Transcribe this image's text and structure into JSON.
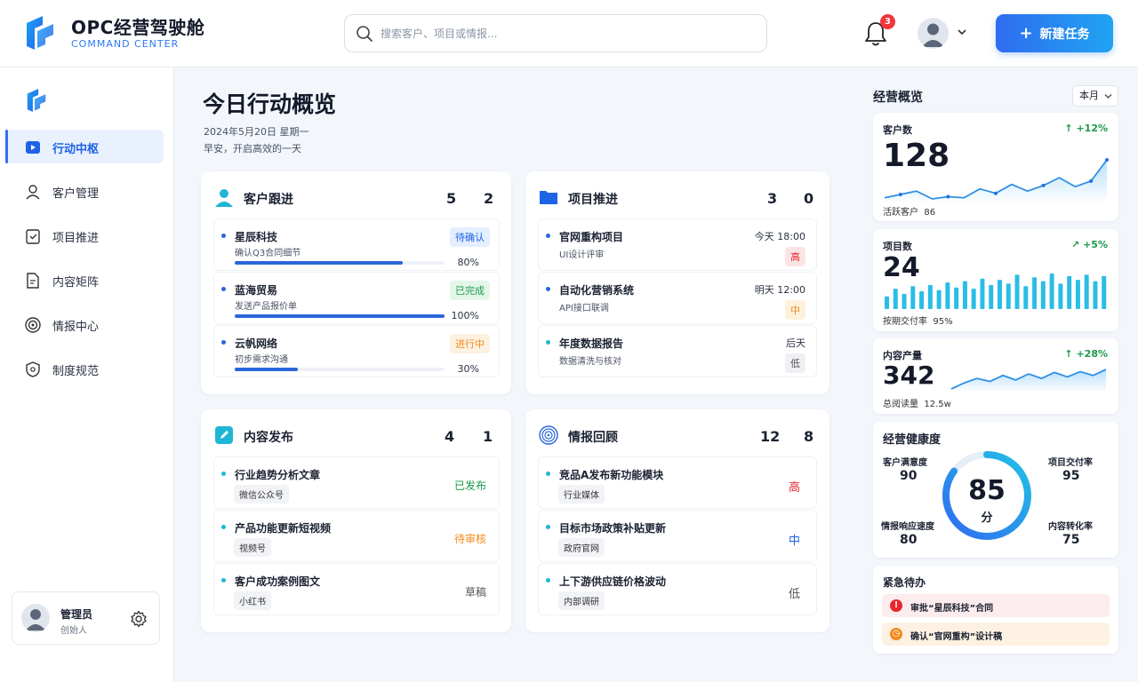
{
  "header": {
    "title": "OPC经营驾驶舱",
    "subtitle": "COMMAND CENTER",
    "search_placeholder": "搜索客户、项目或情报...",
    "notif_count": "3",
    "new_task_label": "新建任务"
  },
  "sidebar": {
    "items": [
      {
        "label": "行动中枢",
        "icon": "action-hub-icon",
        "active": true
      },
      {
        "label": "客户管理",
        "icon": "user-icon",
        "active": false
      },
      {
        "label": "项目推进",
        "icon": "clipboard-check-icon",
        "active": false
      },
      {
        "label": "内容矩阵",
        "icon": "document-icon",
        "active": false
      },
      {
        "label": "情报中心",
        "icon": "radar-icon",
        "active": false
      },
      {
        "label": "制度规范",
        "icon": "shield-icon",
        "active": false
      }
    ],
    "user": {
      "name": "管理员",
      "role": "创始人"
    }
  },
  "main": {
    "title": "今日行动概览",
    "date": "2024年5月20日  星期一",
    "greeting": "早安，开启高效的一天",
    "cards": [
      {
        "title": "客户跟进",
        "n1": "5",
        "n2": "2",
        "items": [
          {
            "name": "星辰科技",
            "sub": "确认Q3合同细节",
            "status": "待确认",
            "progress": 0.8,
            "pct": "80%"
          },
          {
            "name": "蓝海贸易",
            "sub": "发送产品报价单",
            "status": "已完成",
            "progress": 1.0,
            "pct": "100%"
          },
          {
            "name": "云帆网络",
            "sub": "初步需求沟通",
            "status": "进行中",
            "progress": 0.3,
            "pct": "30%"
          }
        ]
      },
      {
        "title": "项目推进",
        "n1": "3",
        "n2": "0",
        "items": [
          {
            "name": "官网重构项目",
            "sub": "UI设计评审",
            "time": "今天 18:00",
            "priority": "高"
          },
          {
            "name": "自动化营销系统",
            "sub": "API接口联调",
            "time": "明天 12:00",
            "priority": "中"
          },
          {
            "name": "年度数据报告",
            "sub": "数据清洗与核对",
            "time": "后天",
            "priority": "低"
          }
        ]
      },
      {
        "title": "内容发布",
        "n1": "4",
        "n2": "1",
        "items": [
          {
            "name": "行业趋势分析文章",
            "channel": "微信公众号",
            "status": "已发布"
          },
          {
            "name": "产品功能更新短视频",
            "channel": "视频号",
            "status": "待审核"
          },
          {
            "name": "客户成功案例图文",
            "channel": "小红书",
            "status": "草稿"
          }
        ]
      },
      {
        "title": "情报回顾",
        "n1": "12",
        "n2": "8",
        "items": [
          {
            "name": "竞品A发布新功能模块",
            "source": "行业媒体",
            "level": "高"
          },
          {
            "name": "目标市场政策补贴更新",
            "source": "政府官网",
            "level": "中"
          },
          {
            "name": "上下游供应链价格波动",
            "source": "内部调研",
            "level": "低"
          }
        ]
      }
    ]
  },
  "overview": {
    "title": "经营概览",
    "period": "本月",
    "stats": [
      {
        "label": "客户数",
        "value": "128",
        "change": "+12%",
        "footer_label": "活跃客户",
        "footer_value": "86",
        "trend": [
          52,
          55,
          58,
          51,
          53,
          52,
          60,
          56,
          64,
          58,
          63,
          70,
          62,
          67,
          86
        ]
      },
      {
        "label": "项目数",
        "value": "24",
        "change": "+5%",
        "footer_label": "按期交付率",
        "footer_value": "95%",
        "bars": [
          10,
          16,
          12,
          18,
          14,
          19,
          15,
          21,
          17,
          22,
          16,
          24,
          19,
          23,
          20,
          27,
          18,
          25,
          22,
          28,
          20,
          26,
          23,
          27,
          22,
          26
        ]
      },
      {
        "label": "内容产量",
        "value": "342",
        "change": "+28%",
        "footer_label": "总阅读量",
        "footer_value": "12.5w",
        "trend": [
          30,
          38,
          44,
          40,
          48,
          42,
          50,
          44,
          52,
          46,
          53,
          48,
          56
        ]
      }
    ],
    "health": {
      "title": "经营健康度",
      "score": "85",
      "unit": "分",
      "score_value": 85,
      "metrics": [
        {
          "label": "客户满意度",
          "value": "90"
        },
        {
          "label": "项目交付率",
          "value": "95"
        },
        {
          "label": "情报响应速度",
          "value": "80"
        },
        {
          "label": "内容转化率",
          "value": "75"
        }
      ]
    },
    "urgent": {
      "title": "紧急待办",
      "items": [
        {
          "icon": "!",
          "text": "审批“星辰科技”合同",
          "color": "#e8262d",
          "bg": "#fdecee"
        },
        {
          "icon": "◷",
          "text": "确认“官网重构”设计稿",
          "color": "#f28a1c",
          "bg": "#fdf1e2"
        }
      ]
    }
  },
  "colors": {
    "accent": "#2d74f0",
    "green": "#1a9a4a",
    "red": "#e8262d",
    "orange": "#f28a1c"
  }
}
